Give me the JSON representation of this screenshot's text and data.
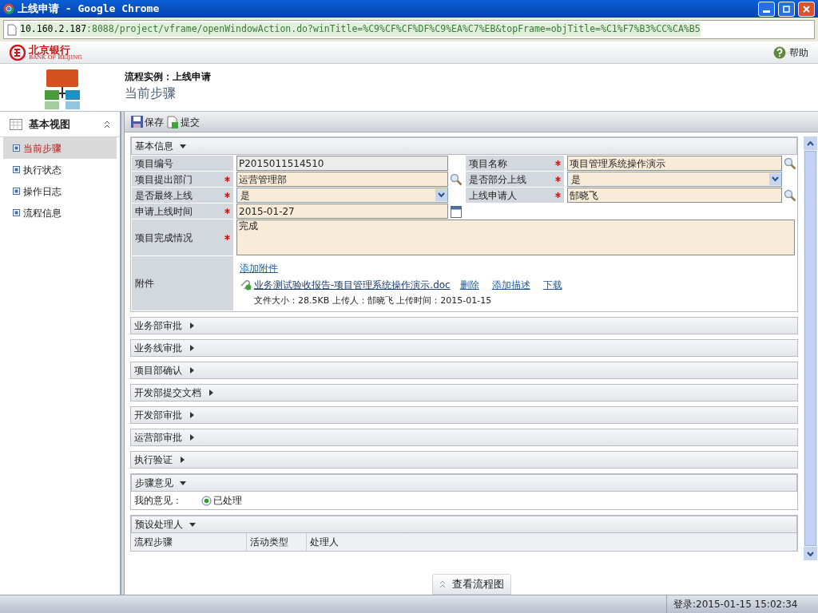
{
  "window": {
    "title": "上线申请 - Google Chrome"
  },
  "address": {
    "host": "10.160.2.187",
    "rest": ":8088/project/vframe/openWindowAction.do?winTitle=%C9%CF%CF%DF%C9%EA%C7%EB&topFrame=objTitle=%C1%F7%B3%CC%CA%B5"
  },
  "header": {
    "logo_cn": "北京银行",
    "logo_en": "BANK OF BEIJING",
    "help": "帮助"
  },
  "banner": {
    "instance": "流程实例：上线申请",
    "step": "当前步骤"
  },
  "sidebar": {
    "title": "基本视图",
    "items": [
      {
        "label": "当前步骤",
        "selected": true
      },
      {
        "label": "执行状态",
        "selected": false
      },
      {
        "label": "操作日志",
        "selected": false
      },
      {
        "label": "流程信息",
        "selected": false
      }
    ]
  },
  "toolbar": [
    {
      "label": "保存",
      "kind": "save"
    },
    {
      "label": "提交",
      "kind": "submit"
    }
  ],
  "basic_info": {
    "title": "基本信息",
    "expanded": true,
    "rows": [
      [
        {
          "label": "项目编号",
          "required": false,
          "value": "P2015011514510",
          "kind": "readonly"
        },
        {
          "label": "项目名称",
          "required": true,
          "value": "项目管理系统操作演示",
          "kind": "lookup"
        }
      ],
      [
        {
          "label": "项目提出部门",
          "required": true,
          "value": "运营管理部",
          "kind": "lookup"
        },
        {
          "label": "是否部分上线",
          "required": true,
          "value": "是",
          "kind": "select"
        }
      ],
      [
        {
          "label": "是否最终上线",
          "required": true,
          "value": "是",
          "kind": "select"
        },
        {
          "label": "上线申请人",
          "required": true,
          "value": "郜晓飞",
          "kind": "lookup"
        }
      ],
      [
        {
          "label": "申请上线时间",
          "required": true,
          "value": "2015-01-27",
          "kind": "date"
        }
      ]
    ],
    "completion": {
      "label": "项目完成情况",
      "required": true,
      "value": "完成"
    },
    "attachment": {
      "label": "附件",
      "add": "添加附件",
      "file": "业务测试验收报告-项目管理系统操作演示.doc",
      "actions": [
        "删除",
        "添加描述",
        "下载"
      ],
      "meta": "文件大小：28.5KB 上传人：郜晓飞 上传时间：2015-01-15"
    }
  },
  "sections": [
    {
      "title": "业务部审批",
      "expanded": false
    },
    {
      "title": "业务线审批",
      "expanded": false
    },
    {
      "title": "项目部确认",
      "expanded": false
    },
    {
      "title": "开发部提交文档",
      "expanded": false
    },
    {
      "title": "开发部审批",
      "expanded": false
    },
    {
      "title": "运营部审批",
      "expanded": false
    },
    {
      "title": "执行验证",
      "expanded": false
    }
  ],
  "opinion": {
    "title": "步骤意见",
    "expanded": true,
    "label": "我的意见：",
    "options": [
      {
        "label": "已处理",
        "selected": true
      }
    ]
  },
  "handlers": {
    "title": "预设处理人",
    "expanded": true,
    "columns": [
      "流程步骤",
      "活动类型",
      "处理人"
    ]
  },
  "flow_button": "查看流程图",
  "status_bar": "登录:2015-01-15 15:02:34"
}
